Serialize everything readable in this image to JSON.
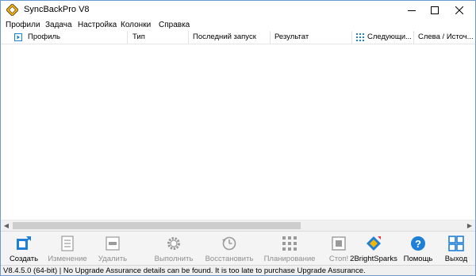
{
  "window": {
    "title": "SyncBackPro V8"
  },
  "menu": [
    {
      "label": "Профили"
    },
    {
      "label": "Задача"
    },
    {
      "label": "Настройка"
    },
    {
      "label": "Колонки"
    },
    {
      "label": "Справка"
    }
  ],
  "grid": {
    "columns": [
      {
        "label": "Профиль"
      },
      {
        "label": "Тип"
      },
      {
        "label": "Последний запуск"
      },
      {
        "label": "Результат"
      },
      {
        "label": "Следующи..."
      },
      {
        "label": "Слева / Источ..."
      }
    ],
    "rows": []
  },
  "toolbar": [
    {
      "label": "Создать",
      "icon": "create-icon",
      "enabled": true
    },
    {
      "label": "Изменение",
      "icon": "edit-icon",
      "enabled": false
    },
    {
      "label": "Удалить",
      "icon": "delete-icon",
      "enabled": false
    },
    {
      "label": "Выполнить",
      "icon": "run-gear-icon",
      "enabled": false
    },
    {
      "label": "Восстановить",
      "icon": "restore-icon",
      "enabled": false
    },
    {
      "label": "Планирование",
      "icon": "schedule-icon",
      "enabled": false
    },
    {
      "label": "Стоп!",
      "icon": "stop-icon",
      "enabled": false
    },
    {
      "label": "2BrightSparks",
      "icon": "brightsparks-icon",
      "enabled": true
    },
    {
      "label": "Помощь",
      "icon": "help-icon",
      "enabled": true
    },
    {
      "label": "Выход",
      "icon": "exit-icon",
      "enabled": true
    }
  ],
  "status": {
    "text": "V8.4.5.0 (64-bit) | No Upgrade Assurance details can be found. It is too late to purchase Upgrade Assurance."
  },
  "colors": {
    "accent_blue": "#1e7fd6",
    "disabled_text": "#8e8e8e",
    "window_border": "#6a9ad0"
  }
}
